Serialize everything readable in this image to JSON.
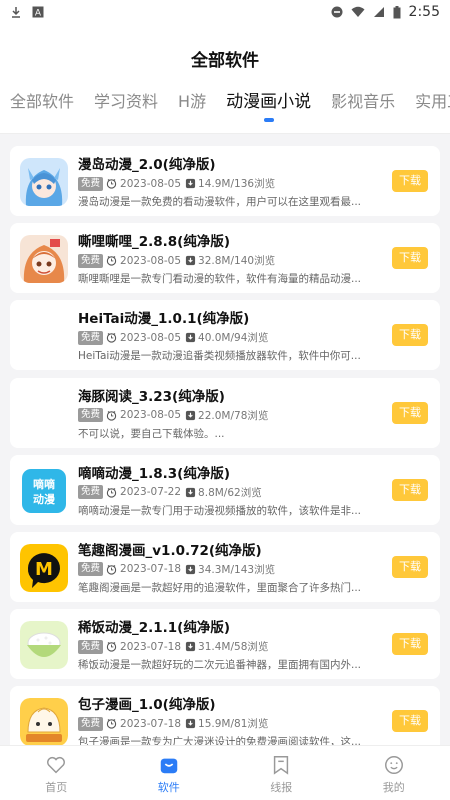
{
  "status_bar": {
    "time": "2:55",
    "left_icons": [
      "download-icon",
      "a-icon"
    ],
    "right_icons": [
      "dnd-icon",
      "wifi-icon",
      "signal-icon",
      "battery-icon"
    ]
  },
  "page": {
    "title": "全部软件"
  },
  "tabs": [
    {
      "label": "全部软件",
      "active": false
    },
    {
      "label": "学习资料",
      "active": false
    },
    {
      "label": "H游",
      "active": false
    },
    {
      "label": "动漫画小说",
      "active": true
    },
    {
      "label": "影视音乐",
      "active": false
    },
    {
      "label": "实用工",
      "active": false
    }
  ],
  "apps": [
    {
      "title": "漫岛动漫_2.0(纯净版)",
      "badge": "免费",
      "date": "2023-08-05",
      "size_views": "14.9M/136浏览",
      "desc": "漫岛动漫是一款免费的看动漫软件，用户可以在这里观看最...",
      "button": "下载",
      "icon": "anime-girl-blue-icon"
    },
    {
      "title": "嘶哩嘶哩_2.8.8(纯净版)",
      "badge": "免费",
      "date": "2023-08-05",
      "size_views": "32.8M/140浏览",
      "desc": "嘶哩嘶哩是一款专门看动漫的软件，软件有海量的精品动漫...",
      "button": "下载",
      "icon": "anime-girl-orange-icon"
    },
    {
      "title": "HeiTai动漫_1.0.1(纯净版)",
      "badge": "免费",
      "date": "2023-08-05",
      "size_views": "40.0M/94浏览",
      "desc": "HeiTai动漫是一款动漫追番类视频播放器软件，软件中你可...",
      "button": "下载",
      "icon": ""
    },
    {
      "title": "海豚阅读_3.23(纯净版)",
      "badge": "免费",
      "date": "2023-08-05",
      "size_views": "22.0M/78浏览",
      "desc": "不可以说，要自己下载体验。...",
      "button": "下载",
      "icon": ""
    },
    {
      "title": "嘀嘀动漫_1.8.3(纯净版)",
      "badge": "免费",
      "date": "2023-07-22",
      "size_views": "8.8M/62浏览",
      "desc": "嘀嘀动漫是一款专门用于动漫视频播放的软件，该软件是非...",
      "button": "下载",
      "icon": "didi-anime-icon",
      "icon_text": "嘀嘀动漫"
    },
    {
      "title": "笔趣阁漫画_v1.0.72(纯净版)",
      "badge": "免费",
      "date": "2023-07-18",
      "size_views": "34.3M/143浏览",
      "desc": "笔趣阁漫画是一款超好用的追漫软件，里面聚合了许多热门...",
      "button": "下载",
      "icon": "m-logo-icon",
      "icon_text": "M"
    },
    {
      "title": "稀饭动漫_2.1.1(纯净版)",
      "badge": "免费",
      "date": "2023-07-18",
      "size_views": "31.4M/58浏览",
      "desc": "稀饭动漫是一款超好玩的二次元追番神器，里面拥有国内外...",
      "button": "下载",
      "icon": "rice-bowl-icon"
    },
    {
      "title": "包子漫画_1.0(纯净版)",
      "badge": "免费",
      "date": "2023-07-18",
      "size_views": "15.9M/81浏览",
      "desc": "包子漫画是一款专为广大漫迷设计的免费漫画阅读软件，这...",
      "button": "下载",
      "icon": "bun-mascot-icon"
    }
  ],
  "bottom_nav": [
    {
      "label": "首页",
      "icon": "heart-icon",
      "active": false
    },
    {
      "label": "软件",
      "icon": "bag-icon",
      "active": true
    },
    {
      "label": "线报",
      "icon": "bookmark-icon",
      "active": false
    },
    {
      "label": "我的",
      "icon": "smile-icon",
      "active": false
    }
  ],
  "colors": {
    "accent": "#2b7cf6",
    "button": "#ffc83a",
    "badge": "#9a9a9a"
  }
}
